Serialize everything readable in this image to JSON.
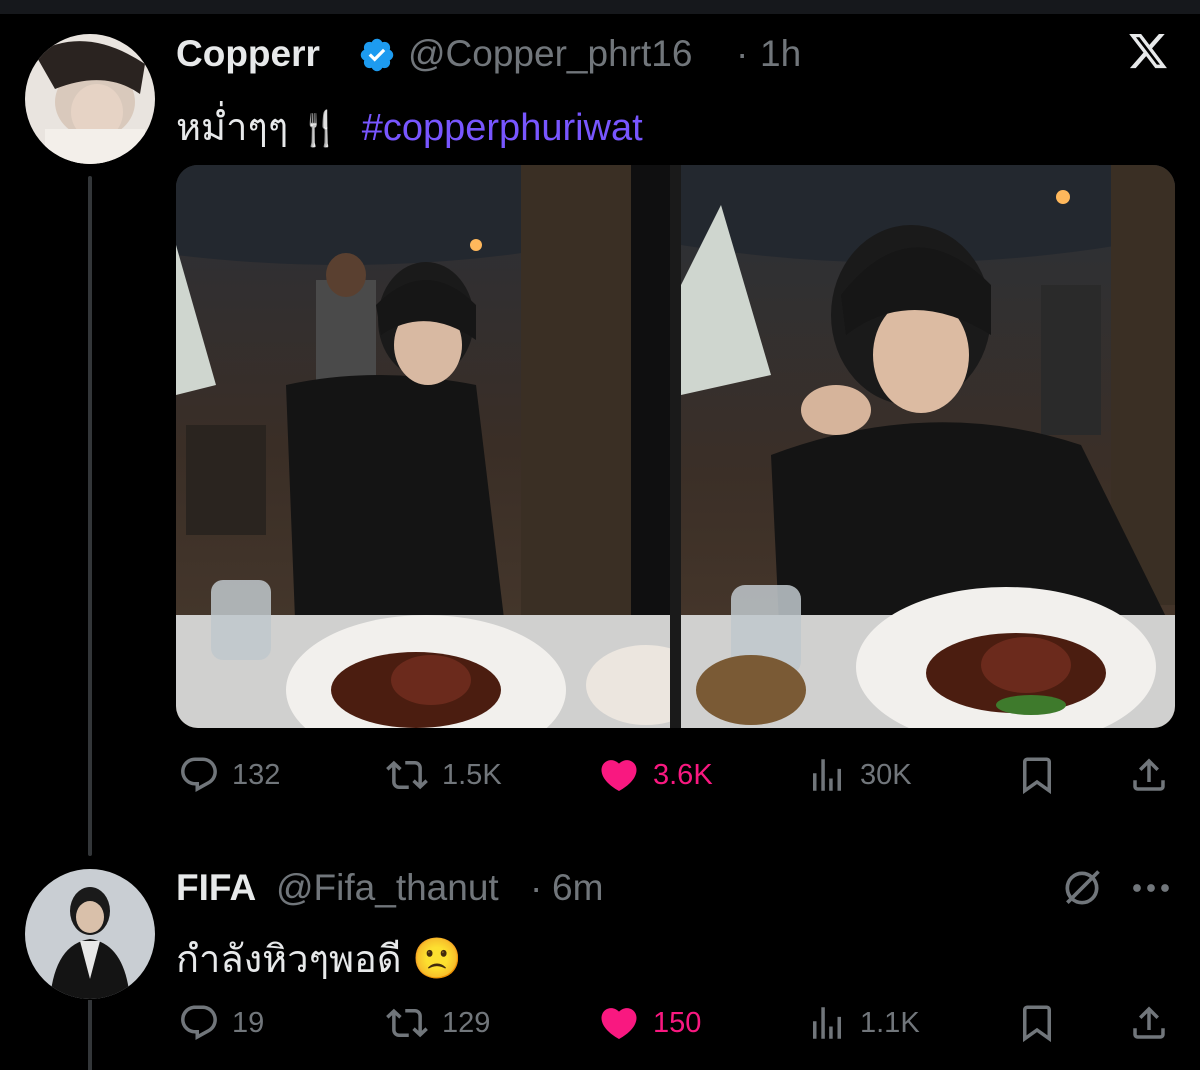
{
  "tweet": {
    "author_name": "Copperr",
    "handle": "@Copper_phrt16",
    "separator": "·",
    "time": "1h",
    "text_thai": "หม่ำๆๆ",
    "text_emoji": "🍴",
    "hashtag": "#copperphuriwat",
    "stats": {
      "replies": "132",
      "retweets": "1.5K",
      "likes": "3.6K",
      "views": "30K"
    },
    "liked": true
  },
  "reply": {
    "author_name": "FIFA",
    "handle": "@Fifa_thanut",
    "separator": "·",
    "time": "6m",
    "text": "กำลังหิวๆพอดี",
    "text_emoji": "🙁",
    "stats": {
      "replies": "19",
      "retweets": "129",
      "likes": "150",
      "views": "1.1K"
    },
    "liked": true
  },
  "colors": {
    "background": "#000000",
    "text": "#e7e9ea",
    "muted": "#71767b",
    "hashtag": "#7856ff",
    "like": "#f91880",
    "verified": "#1d9bf0"
  },
  "icons": [
    "x-logo-icon",
    "verified-icon",
    "reply-icon",
    "retweet-icon",
    "heart-icon",
    "views-icon",
    "bookmark-icon",
    "share-icon",
    "grok-icon",
    "more-icon"
  ]
}
